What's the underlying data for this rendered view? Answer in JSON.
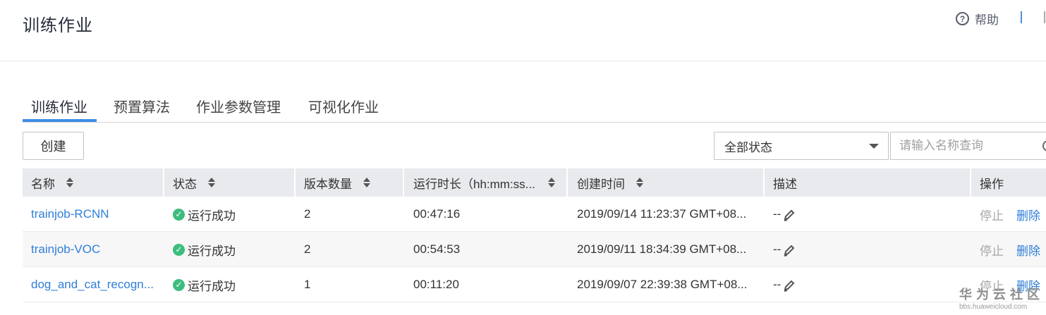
{
  "header": {
    "title": "训练作业",
    "help_label": "帮助",
    "help_icon": "question-circle-icon"
  },
  "tabs": [
    {
      "label": "训练作业",
      "active": true
    },
    {
      "label": "预置算法",
      "active": false
    },
    {
      "label": "作业参数管理",
      "active": false
    },
    {
      "label": "可视化作业",
      "active": false
    }
  ],
  "toolbar": {
    "create_label": "创建",
    "status_filter": "全部状态",
    "search_placeholder": "请输入名称查询"
  },
  "table": {
    "columns": [
      "名称",
      "状态",
      "版本数量",
      "运行时长（hh:mm:ss...",
      "创建时间",
      "描述",
      "操作"
    ],
    "rows": [
      {
        "name": "trainjob-RCNN",
        "status": "运行成功",
        "versions": "2",
        "duration": "00:47:16",
        "created": "2019/09/14 11:23:37 GMT+08...",
        "desc": "--",
        "op_stop": "停止",
        "op_delete": "删除"
      },
      {
        "name": "trainjob-VOC",
        "status": "运行成功",
        "versions": "2",
        "duration": "00:54:53",
        "created": "2019/09/11 18:34:39 GMT+08...",
        "desc": "--",
        "op_stop": "停止",
        "op_delete": "删除"
      },
      {
        "name": "dog_and_cat_recogn...",
        "status": "运行成功",
        "versions": "1",
        "duration": "00:11:20",
        "created": "2019/09/07 22:39:38 GMT+08...",
        "desc": "--",
        "op_stop": "停止",
        "op_delete": "删除"
      }
    ]
  },
  "watermark": {
    "main": "华为云社区",
    "sub": "bbs.huaweicloud.com"
  },
  "colors": {
    "accent": "#3f8ee8",
    "link": "#2f7ed8",
    "success": "#3dbd7d",
    "header_bg": "#e8eaee"
  }
}
